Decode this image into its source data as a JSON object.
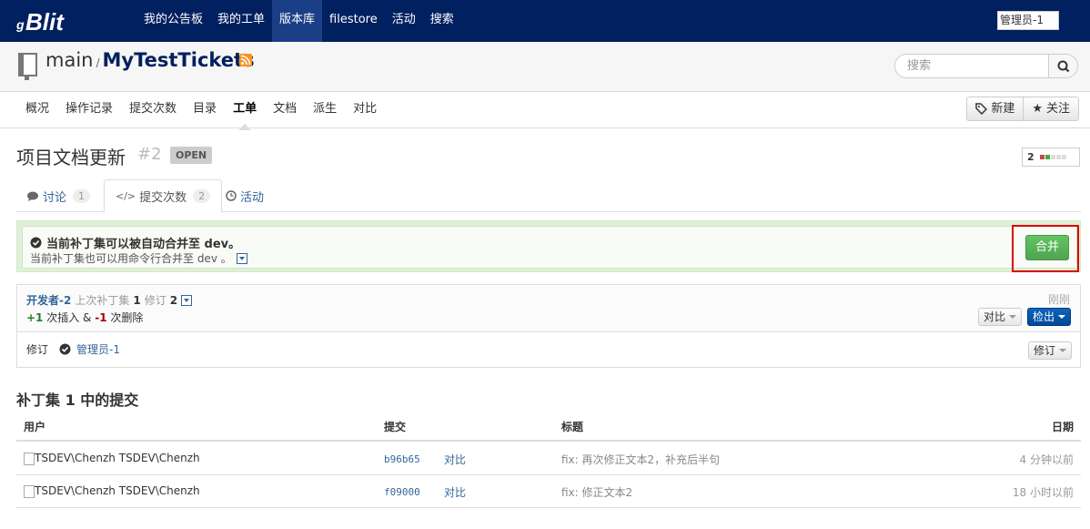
{
  "nav": {
    "logo_text": "Blit",
    "items": [
      "我的公告板",
      "我的工单",
      "版本库",
      "filestore",
      "活动",
      "搜索"
    ],
    "active_index": 2,
    "user_alt": "管理员-1"
  },
  "repo": {
    "project": "main",
    "separator": "/",
    "name": "MyTestTickets",
    "search_placeholder": "搜索"
  },
  "subnav": {
    "items": [
      "概况",
      "操作记录",
      "提交次数",
      "目录",
      "工单",
      "文档",
      "派生",
      "对比"
    ],
    "active_index": 4,
    "new_label": "新建",
    "watch_label": "关注"
  },
  "ticket": {
    "title": "项目文档更新",
    "number": "#2",
    "status": "OPEN",
    "votes": "2"
  },
  "tabs": [
    {
      "label": "讨论",
      "count": "1"
    },
    {
      "label": "提交次数",
      "count": "2"
    },
    {
      "label": "活动",
      "count": ""
    }
  ],
  "merge": {
    "line1": "当前补丁集可以被自动合并至 dev。",
    "line2": "当前补丁集也可以用命令行合并至 dev 。",
    "button": "合并"
  },
  "patchset": {
    "author": "开发者-2",
    "summary_pre": "上次补丁集",
    "ps_num": "1",
    "rev_label": "修订",
    "rev_num": "2",
    "ins": "+1",
    "ins_label": "次插入 &",
    "del": "-1",
    "del_label": "次删除",
    "time": "刚刚",
    "compare_btn": "对比",
    "checkout_btn": "检出",
    "review_label": "修订",
    "reviewer": "管理员-1",
    "review_btn": "修订"
  },
  "commits": {
    "title": "补丁集 1 中的提交",
    "headers": {
      "user": "用户",
      "commit": "提交",
      "title": "标题",
      "date": "日期"
    },
    "rows": [
      {
        "user": "TSDEV\\Chenzh",
        "user_img_alt": "TSDEV\\Chenzh",
        "sha": "b96b65",
        "compare": "对比",
        "message": "fix: 再次修正文本2，补充后半句",
        "date": "4 分钟以前"
      },
      {
        "user": "TSDEV\\Chenzh",
        "user_img_alt": "TSDEV\\Chenzh",
        "sha": "f09000",
        "compare": "对比",
        "message": "fix: 修正文本2",
        "date": "18 小时以前"
      }
    ]
  }
}
